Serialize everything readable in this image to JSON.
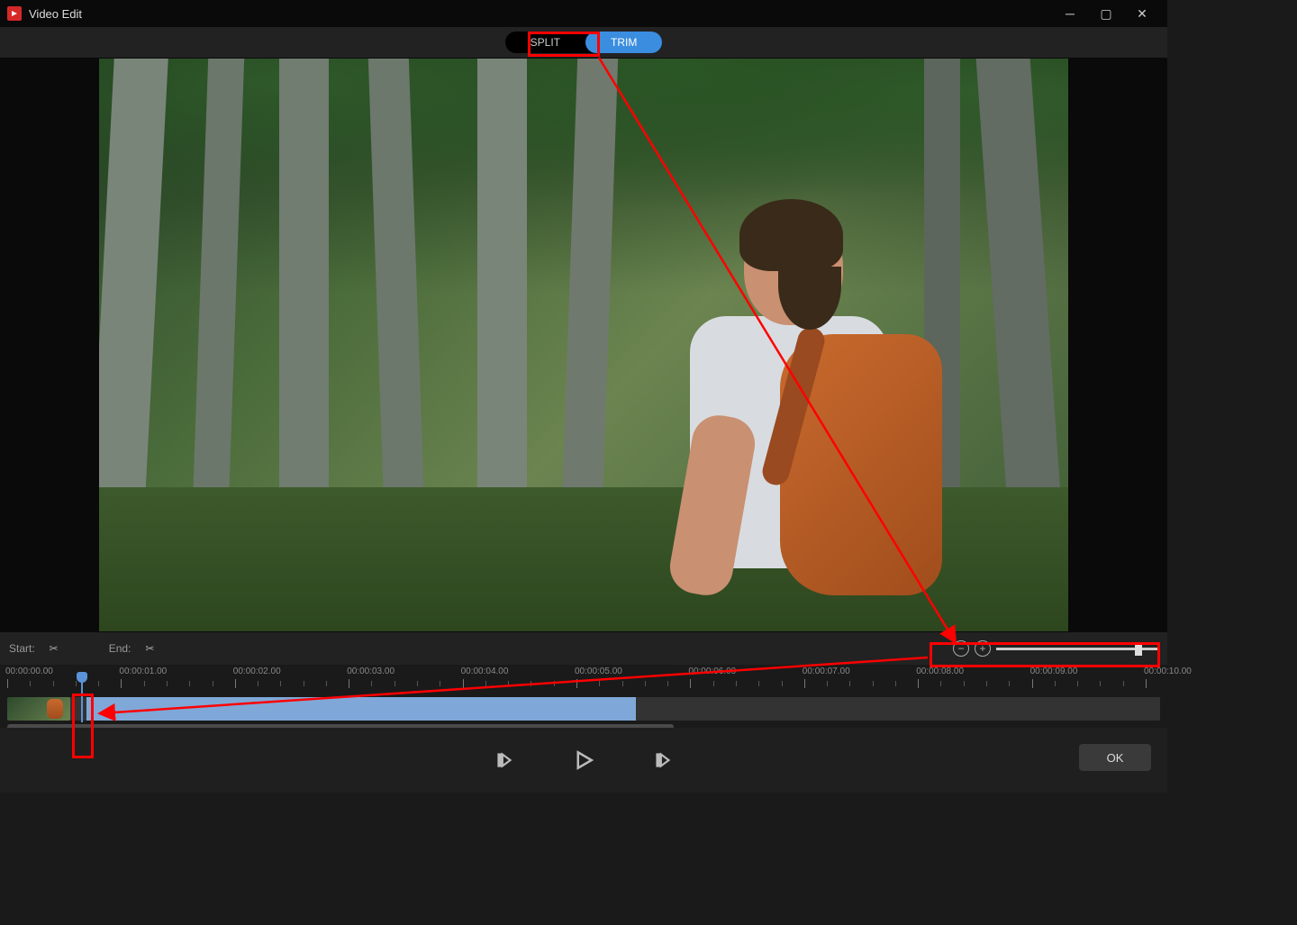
{
  "window": {
    "title": "Video Edit"
  },
  "tabs": {
    "split": "SPLIT",
    "trim": "TRIM",
    "active": "trim"
  },
  "trim_controls": {
    "start_label": "Start:",
    "end_label": "End:"
  },
  "ruler": {
    "labels": [
      "00:00:00.00",
      "00:00:01.00",
      "00:00:02.00",
      "00:00:03.00",
      "00:00:04.00",
      "00:00:05.00",
      "00:00:06.00",
      "00:00:07.00",
      "00:00:08.00",
      "00:00:09.00",
      "00:00:10.00"
    ]
  },
  "zoom": {
    "minus": "−",
    "plus": "+"
  },
  "footer": {
    "ok": "OK"
  },
  "icons": {
    "scissors": "✂"
  }
}
